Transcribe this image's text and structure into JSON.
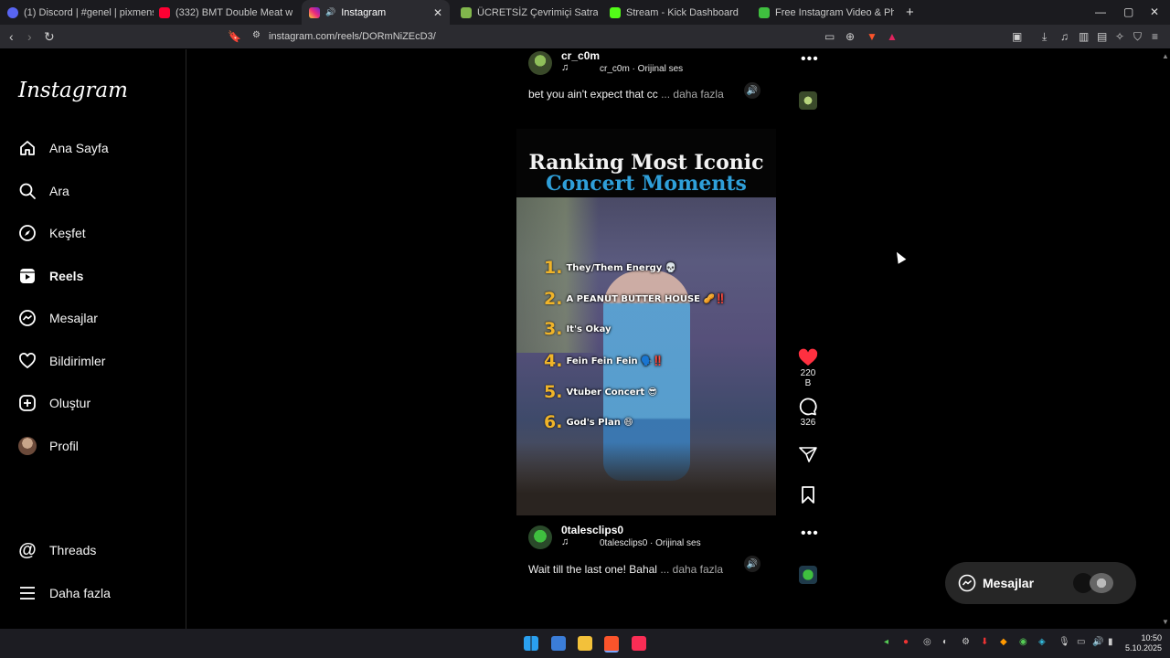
{
  "browser": {
    "tabs": [
      {
        "label": "(1) Discord | #genel | pixmens",
        "fav_color": "#5865f2"
      },
      {
        "label": "(332) BMT Double Meat w/ Bacon - Y",
        "fav_color": "#ff0033"
      },
      {
        "label": "Instagram",
        "fav_color": "#d6249f",
        "active": true
      },
      {
        "label": "ÜCRETSİZ Çevrimiçi Satranç Oynayın",
        "fav_color": "#81b64c"
      },
      {
        "label": "Stream - Kick Dashboard",
        "fav_color": "#53fc18"
      },
      {
        "label": "Free Instagram Video & Photo Down",
        "fav_color": "#3fbf3f"
      }
    ],
    "new_tab": "+",
    "url": "instagram.com/reels/DORmNiZEcD3/",
    "window_controls": [
      "—",
      "▢",
      "✕"
    ]
  },
  "app": {
    "logo": "Instagram"
  },
  "sidebar": {
    "items": [
      {
        "label": "Ana Sayfa",
        "icon": "home-icon"
      },
      {
        "label": "Ara",
        "icon": "search-icon"
      },
      {
        "label": "Keşfet",
        "icon": "compass-icon"
      },
      {
        "label": "Reels",
        "icon": "reels-icon",
        "active": true
      },
      {
        "label": "Mesajlar",
        "icon": "messenger-icon"
      },
      {
        "label": "Bildirimler",
        "icon": "heart-icon"
      },
      {
        "label": "Oluştur",
        "icon": "plus-square-icon"
      },
      {
        "label": "Profil",
        "icon": "avatar"
      }
    ],
    "bottom_items": [
      {
        "label": "Threads",
        "icon": "threads-icon"
      },
      {
        "label": "Daha fazla",
        "icon": "menu-icon"
      }
    ]
  },
  "reel_prev": {
    "username": "cr_c0m",
    "audio": "cr_c0m · Orijinal ses",
    "caption": "bet you ain't expect that cc",
    "more": "... daha fazla"
  },
  "reel_current": {
    "video_title_line1": "Ranking Most Iconic",
    "video_title_line2": "Concert Moments",
    "ranking": [
      {
        "num": "1.",
        "text": "They/Them Energy 💀"
      },
      {
        "num": "2.",
        "text": "A PEANUT BUTTER HOUSE 🥜‼️"
      },
      {
        "num": "3.",
        "text": "It's Okay"
      },
      {
        "num": "4.",
        "text": "Fein Fein Fein 🗣️‼️"
      },
      {
        "num": "5.",
        "text": "Vtuber Concert 😎"
      },
      {
        "num": "6.",
        "text": "God's Plan 😄"
      }
    ],
    "likes": "220 B",
    "comments": "326",
    "username": "0talesclips0",
    "audio": "0talesclips0 · Orijinal ses",
    "caption": "Wait till the last one! Bahal",
    "more": "... daha fazla"
  },
  "messages_pill": {
    "label": "Mesajlar"
  },
  "taskbar": {
    "clock_time": "10:50",
    "clock_date": "5.10.2025"
  },
  "colors": {
    "accent_like": "#ff3040",
    "title_blue": "#2f9fd9",
    "rank_gold": "#f0b429"
  }
}
